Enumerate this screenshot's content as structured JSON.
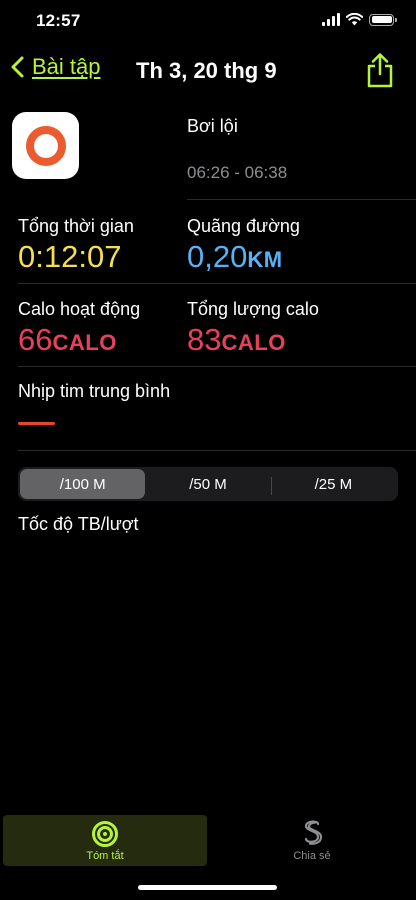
{
  "status_bar": {
    "time": "12:57"
  },
  "nav": {
    "back_label": "Bài tập",
    "title": "Th 3, 20 thg 9"
  },
  "workout": {
    "name": "Bơi lội",
    "time_range": "06:26 - 06:38"
  },
  "metrics": {
    "total_time": {
      "label": "Tổng thời gian",
      "value": "0:12:07"
    },
    "distance": {
      "label": "Quãng đường",
      "value": "0,20",
      "unit": "KM"
    },
    "active_calories": {
      "label": "Calo hoạt động",
      "value": "66",
      "unit": "CALO"
    },
    "total_calories": {
      "label": "Tổng lượng calo",
      "value": "83",
      "unit": "CALO"
    },
    "heart_rate": {
      "label": "Nhịp tim trung bình"
    }
  },
  "segments": {
    "options": [
      "/100 M",
      "/50 M",
      "/25 M"
    ],
    "selected": "/100 M"
  },
  "pace": {
    "label": "Tốc độ TB/lượt"
  },
  "tabbar": {
    "summary_label": "Tóm tắt",
    "share_label": "Chia sẻ"
  },
  "colors": {
    "accent": "#b6f43b",
    "yellow": "#f4e04d",
    "blue": "#57b2f5",
    "pink": "#e8405c",
    "heart_dash": "#e8442e"
  }
}
